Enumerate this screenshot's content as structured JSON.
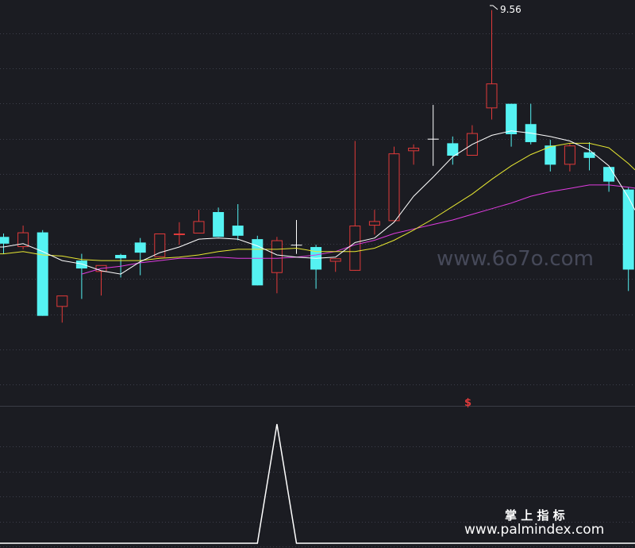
{
  "chart_data": [
    {
      "type": "candlestick",
      "title": "",
      "xlabel": "",
      "ylabel": "",
      "ylim": [
        6.2,
        9.65
      ],
      "grid": true,
      "max_label": "9.56",
      "marker_text": "$",
      "colors": {
        "up": "#e03a3a",
        "down": "#55f2f2",
        "doji": "#ffffff",
        "ma_fast": "#ffffff",
        "ma_mid": "#e8e832",
        "ma_slow": "#e03ce0"
      },
      "candles": [
        {
          "o": 7.55,
          "h": 7.58,
          "l": 7.4,
          "c": 7.49
        },
        {
          "o": 7.46,
          "h": 7.65,
          "l": 7.44,
          "c": 7.59
        },
        {
          "o": 7.59,
          "h": 7.61,
          "l": 6.85,
          "c": 6.85
        },
        {
          "o": 6.93,
          "h": 6.98,
          "l": 6.79,
          "c": 7.03
        },
        {
          "o": 7.34,
          "h": 7.4,
          "l": 7.0,
          "c": 7.27
        },
        {
          "o": 7.24,
          "h": 7.29,
          "l": 7.03,
          "c": 7.3
        },
        {
          "o": 7.39,
          "h": 7.4,
          "l": 7.19,
          "c": 7.36
        },
        {
          "o": 7.5,
          "h": 7.54,
          "l": 7.21,
          "c": 7.41
        },
        {
          "o": 7.37,
          "h": 7.58,
          "l": 7.37,
          "c": 7.58
        },
        {
          "o": 7.57,
          "h": 7.68,
          "l": 7.48,
          "c": 7.58
        },
        {
          "o": 7.58,
          "h": 7.79,
          "l": 7.58,
          "c": 7.69
        },
        {
          "o": 7.77,
          "h": 7.81,
          "l": 7.55,
          "c": 7.55
        },
        {
          "o": 7.65,
          "h": 7.84,
          "l": 7.52,
          "c": 7.56
        },
        {
          "o": 7.53,
          "h": 7.56,
          "l": 7.12,
          "c": 7.12
        },
        {
          "o": 7.23,
          "h": 7.55,
          "l": 7.05,
          "c": 7.52
        },
        {
          "o": 7.48,
          "h": 7.7,
          "l": 7.4,
          "c": 7.48
        },
        {
          "o": 7.46,
          "h": 7.48,
          "l": 7.09,
          "c": 7.26
        },
        {
          "o": 7.33,
          "h": 7.36,
          "l": 7.24,
          "c": 7.36
        },
        {
          "o": 7.25,
          "h": 8.4,
          "l": 7.25,
          "c": 7.65
        },
        {
          "o": 7.65,
          "h": 7.79,
          "l": 7.57,
          "c": 7.69
        },
        {
          "o": 7.69,
          "h": 8.35,
          "l": 7.69,
          "c": 8.29
        },
        {
          "o": 8.31,
          "h": 8.37,
          "l": 8.19,
          "c": 8.34
        },
        {
          "o": 8.42,
          "h": 8.72,
          "l": 8.18,
          "c": 8.42
        },
        {
          "o": 8.38,
          "h": 8.44,
          "l": 8.19,
          "c": 8.27
        },
        {
          "o": 8.27,
          "h": 8.54,
          "l": 8.27,
          "c": 8.47
        },
        {
          "o": 8.69,
          "h": 9.56,
          "l": 8.59,
          "c": 8.91
        },
        {
          "o": 8.73,
          "h": 8.73,
          "l": 8.35,
          "c": 8.46
        },
        {
          "o": 8.55,
          "h": 8.73,
          "l": 8.37,
          "c": 8.39
        },
        {
          "o": 8.36,
          "h": 8.41,
          "l": 8.13,
          "c": 8.19
        },
        {
          "o": 8.19,
          "h": 8.38,
          "l": 8.13,
          "c": 8.36
        },
        {
          "o": 8.3,
          "h": 8.39,
          "l": 8.14,
          "c": 8.25
        },
        {
          "o": 8.17,
          "h": 8.17,
          "l": 7.95,
          "c": 8.04
        },
        {
          "o": 7.97,
          "h": 7.99,
          "l": 7.07,
          "c": 7.26
        }
      ],
      "ma_fast": [
        7.46,
        7.49,
        7.42,
        7.34,
        7.31,
        7.25,
        7.22,
        7.33,
        7.41,
        7.46,
        7.53,
        7.54,
        7.53,
        7.47,
        7.39,
        7.37,
        7.36,
        7.37,
        7.5,
        7.54,
        7.68,
        7.91,
        8.08,
        8.26,
        8.37,
        8.45,
        8.49,
        8.47,
        8.44,
        8.4,
        8.32,
        8.18,
        7.9
      ],
      "ma_mid": [
        7.4,
        7.42,
        7.39,
        7.38,
        7.35,
        7.34,
        7.34,
        7.34,
        7.36,
        7.37,
        7.39,
        7.42,
        7.44,
        7.44,
        7.44,
        7.45,
        7.42,
        7.42,
        7.42,
        7.45,
        7.52,
        7.61,
        7.71,
        7.82,
        7.93,
        8.06,
        8.18,
        8.28,
        8.35,
        8.38,
        8.38,
        8.34,
        8.2
      ],
      "ma_slow": [
        null,
        null,
        null,
        null,
        7.22,
        7.27,
        7.29,
        7.32,
        7.34,
        7.36,
        7.36,
        7.37,
        7.36,
        7.36,
        7.36,
        7.37,
        7.39,
        7.42,
        7.48,
        7.52,
        7.58,
        7.62,
        7.66,
        7.7,
        7.75,
        7.8,
        7.85,
        7.91,
        7.95,
        7.98,
        8.01,
        8.01,
        7.99
      ]
    },
    {
      "type": "line",
      "title": "",
      "xlabel": "",
      "ylabel": "",
      "ylim": [
        0,
        1
      ],
      "color": "#ffffff",
      "values": [
        0,
        0,
        0,
        0,
        0,
        0,
        0,
        0,
        0,
        0,
        0,
        0,
        0,
        0,
        1,
        0,
        0,
        0,
        0,
        0,
        0,
        0,
        0,
        0,
        0,
        0,
        0,
        0,
        0,
        0,
        0,
        0,
        0
      ]
    }
  ],
  "watermarks": {
    "site_small": "www.6o7o.com",
    "brand_cn": "掌 上 指 标",
    "brand_url": "www.palmindex.com"
  }
}
